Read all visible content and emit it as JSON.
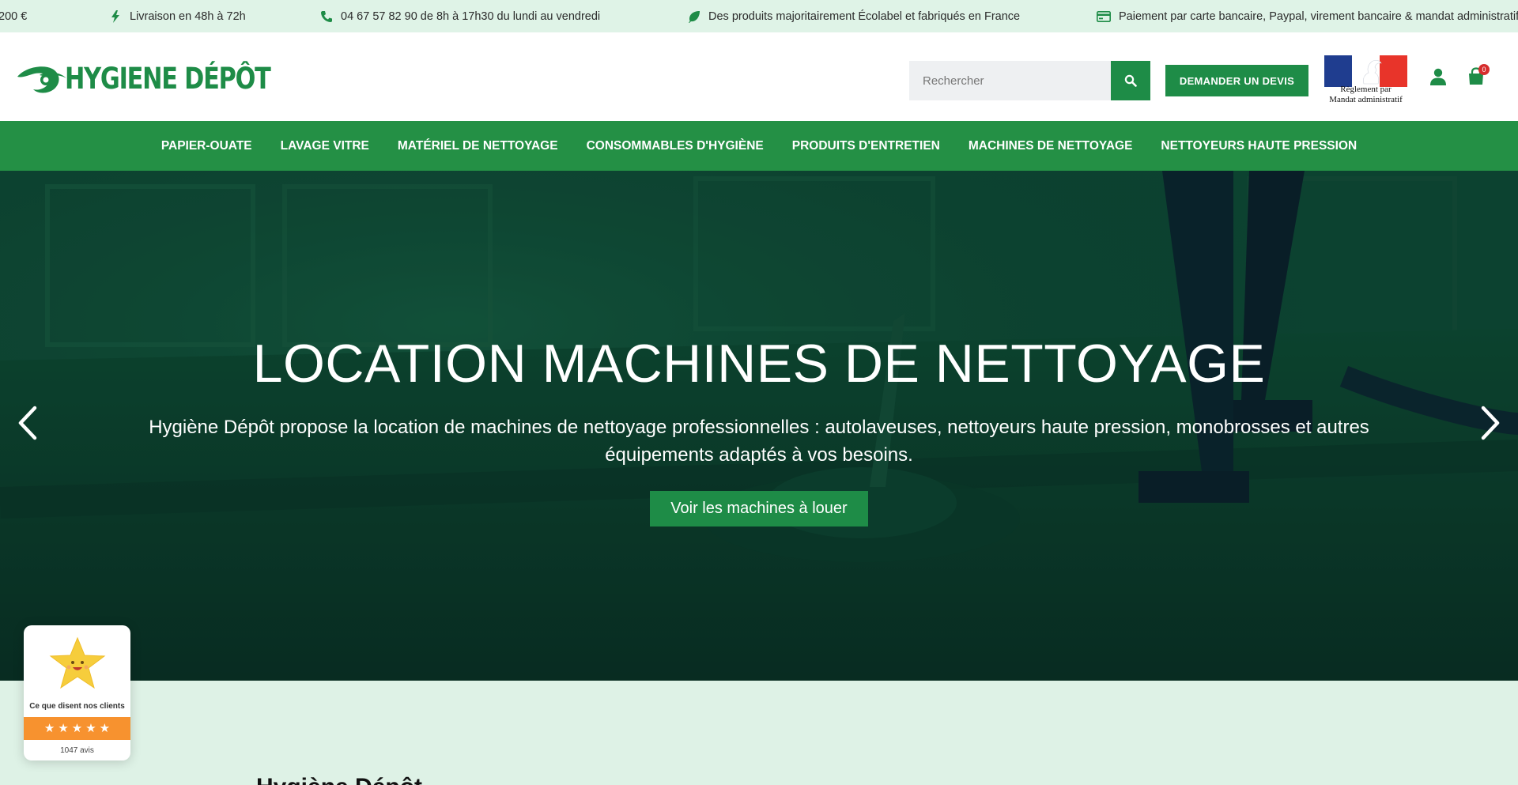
{
  "topbar": {
    "items": [
      {
        "text": "200 €",
        "icon": "truck-icon"
      },
      {
        "text": "Livraison en 48h à 72h",
        "icon": "bolt-icon"
      },
      {
        "text": "04 67 57 82 90 de 8h à 17h30 du lundi au vendredi",
        "icon": "phone-icon"
      },
      {
        "text": "Des produits majoritairement Écolabel et fabriqués en France",
        "icon": "leaf-icon"
      },
      {
        "text": "Paiement par carte bancaire, Paypal, virement bancaire & mandat administratif",
        "icon": "credit-card-icon"
      }
    ]
  },
  "header": {
    "logo_text": "HYGIENE DÉPÔT",
    "search": {
      "placeholder": "Rechercher"
    },
    "devis_label": "DEMANDER UN DEVIS",
    "mandat_text_line1": "Règlement par",
    "mandat_text_line2": "Mandat administratif",
    "cart_count": "0"
  },
  "nav": {
    "items": [
      "PAPIER-OUATE",
      "LAVAGE VITRE",
      "MATÉRIEL DE NETTOYAGE",
      "CONSOMMABLES D'HYGIÈNE",
      "PRODUITS D'ENTRETIEN",
      "MACHINES DE NETTOYAGE",
      "NETTOYEURS HAUTE PRESSION"
    ]
  },
  "hero": {
    "title": "LOCATION MACHINES DE NETTOYAGE",
    "subtitle": "Hygiène Dépôt propose la location de machines de nettoyage professionnelles : autolaveuses, nettoyeurs haute pression, monobrosses et autres équipements adaptés à vos besoins.",
    "cta": "Voir les machines à louer"
  },
  "section": {
    "title": "Hygiène Dépôt"
  },
  "review_widget": {
    "label": "Ce que disent nos clients",
    "rating": 5,
    "count": "1047 avis"
  },
  "colors": {
    "brand_green": "#1e8c47",
    "nav_green": "#249045",
    "topbar_bg": "#dff3e7",
    "review_orange": "#f7922f"
  }
}
